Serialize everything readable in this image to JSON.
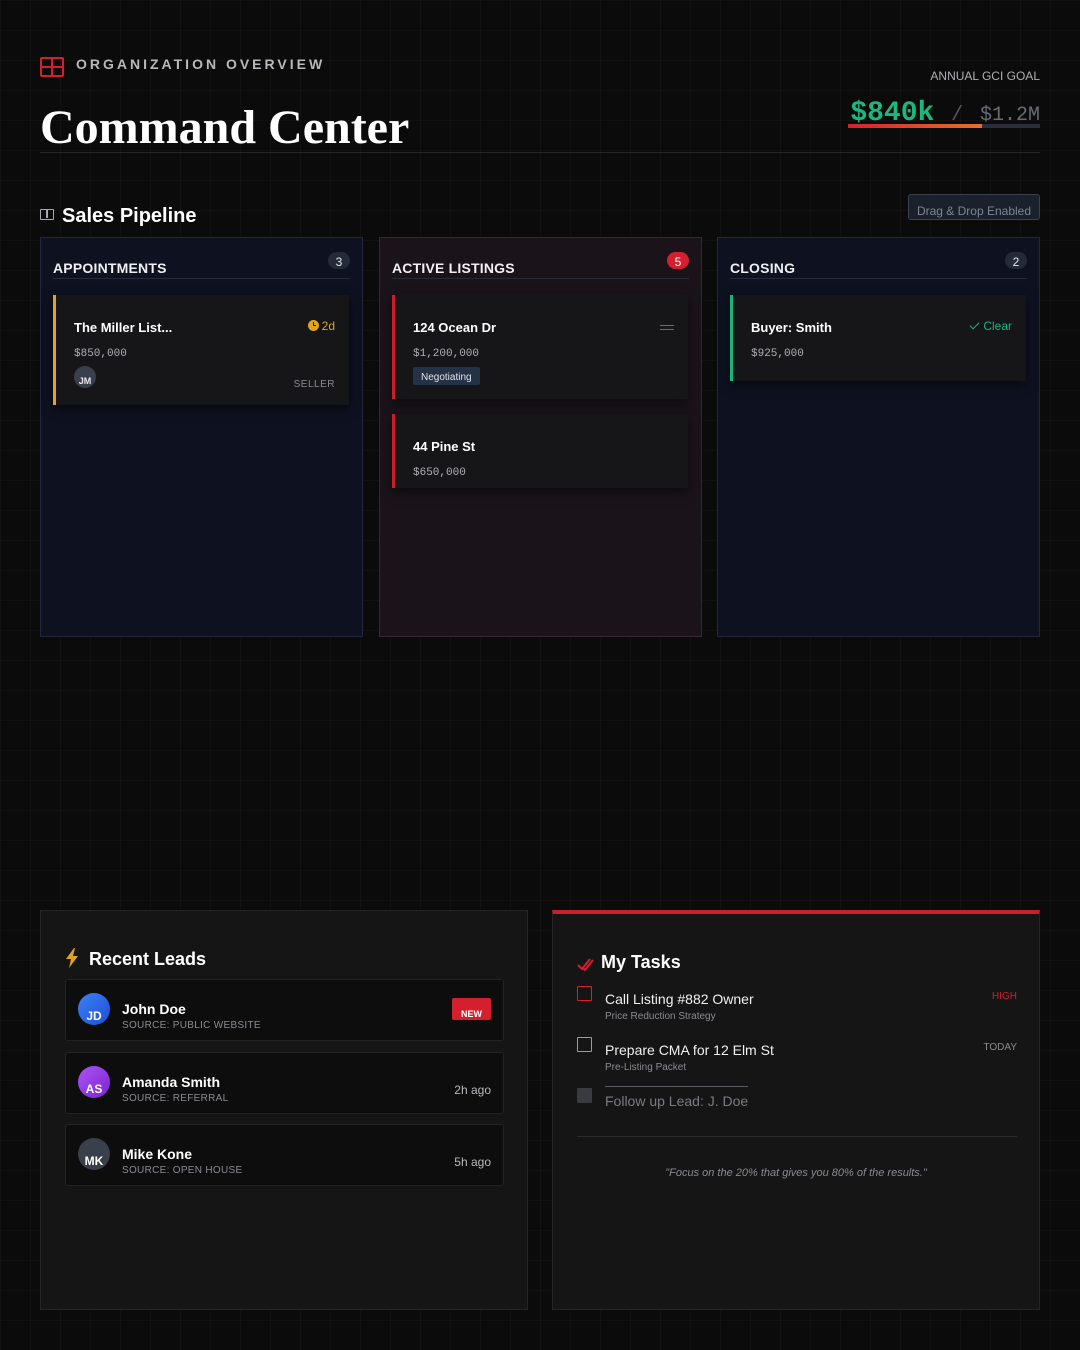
{
  "header": {
    "overview_label": "ORGANIZATION OVERVIEW",
    "title": "Command Center",
    "goal_label": "ANNUAL GCI GOAL",
    "goal_current": "$840k",
    "goal_separator": "/",
    "goal_target": "$1.2M",
    "goal_progress_fraction": 0.7
  },
  "pipeline": {
    "title": "Sales Pipeline",
    "drag_drop_label": "Drag & Drop Enabled",
    "columns": [
      {
        "title": "APPOINTMENTS",
        "count": "3",
        "cards": [
          {
            "name": "The Miller List...",
            "price": "$850,000",
            "meta": "2d",
            "avatar": "JM",
            "role": "SELLER"
          }
        ]
      },
      {
        "title": "ACTIVE LISTINGS",
        "count": "5",
        "cards": [
          {
            "name": "124 Ocean Dr",
            "price": "$1,200,000",
            "tag": "Negotiating"
          },
          {
            "name": "44 Pine St",
            "price": "$650,000"
          }
        ]
      },
      {
        "title": "CLOSING",
        "count": "2",
        "cards": [
          {
            "name": "Buyer: Smith",
            "price": "$925,000",
            "meta": "Clear"
          }
        ]
      }
    ]
  },
  "leads": {
    "title": "Recent Leads",
    "items": [
      {
        "initials": "JD",
        "name": "John Doe",
        "source": "SOURCE: PUBLIC WEBSITE",
        "badge": "NEW"
      },
      {
        "initials": "AS",
        "name": "Amanda Smith",
        "source": "SOURCE: REFERRAL",
        "time": "2h ago"
      },
      {
        "initials": "MK",
        "name": "Mike Kone",
        "source": "SOURCE: OPEN HOUSE",
        "time": "5h ago"
      }
    ]
  },
  "tasks": {
    "title": "My Tasks",
    "items": [
      {
        "name": "Call Listing #882 Owner",
        "sub": "Price Reduction Strategy",
        "priority": "HIGH"
      },
      {
        "name": "Prepare CMA for 12 Elm St",
        "sub": "Pre-Listing Packet",
        "priority": "TODAY"
      },
      {
        "name": "Follow up Lead: J. Doe"
      }
    ],
    "quote": "\"Focus on the 20% that gives you 80% of the results.\""
  },
  "colors": {
    "accent_red": "#d4202e",
    "success_green": "#17b47c",
    "warning_amber": "#e0a51a"
  }
}
